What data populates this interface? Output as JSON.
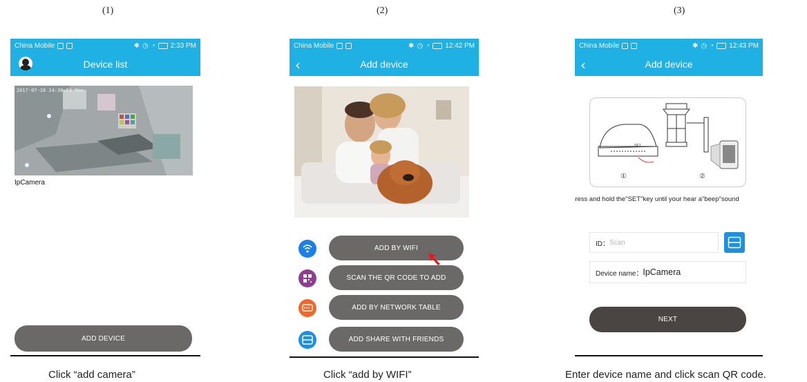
{
  "steps": [
    {
      "number": "(1)",
      "caption": "Click “add camera”"
    },
    {
      "number": "(2)",
      "caption": "Click “add by WIFI”"
    },
    {
      "number": "(3)",
      "caption": "Enter device name and click scan QR code."
    }
  ],
  "colors": {
    "accent": "#1fb1e3",
    "button": "#6b6968",
    "button_dark": "#4a4442"
  },
  "screen1": {
    "status": {
      "carrier": "China Mobile",
      "time": "2:33 PM"
    },
    "title": "Device list",
    "camera_overlay_text": "2017-07-18 14:38:53 Mon",
    "camera_name": "IpCamera",
    "add_device_label": "ADD DEVICE"
  },
  "screen2": {
    "status": {
      "carrier": "China Mobile",
      "time": "12:42 PM"
    },
    "title": "Add device",
    "buttons": [
      {
        "label": "ADD BY WIFI",
        "icon": "wifi-icon",
        "color": "#1b7fe6"
      },
      {
        "label": "SCAN THE QR CODE TO ADD",
        "icon": "qr-code-icon",
        "color": "#8e3e8e"
      },
      {
        "label": "ADD BY NETWORK TABLE",
        "icon": "network-port-icon",
        "color": "#ef6a2a"
      },
      {
        "label": "ADD SHARE WITH FRIENDS",
        "icon": "share-icon",
        "color": "#1f8fe0"
      }
    ]
  },
  "screen3": {
    "status": {
      "carrier": "China Mobile",
      "time": "12:43 PM"
    },
    "title": "Add device",
    "illustration_labels": [
      "①",
      "②"
    ],
    "instruction": "Press and hold the\"SET\"key until your hear a\"beep\"sound",
    "id_label": "ID：",
    "id_placeholder": "Scan",
    "device_name_label": "Device name：",
    "device_name_value": "IpCamera",
    "next_label": "NEXT"
  }
}
